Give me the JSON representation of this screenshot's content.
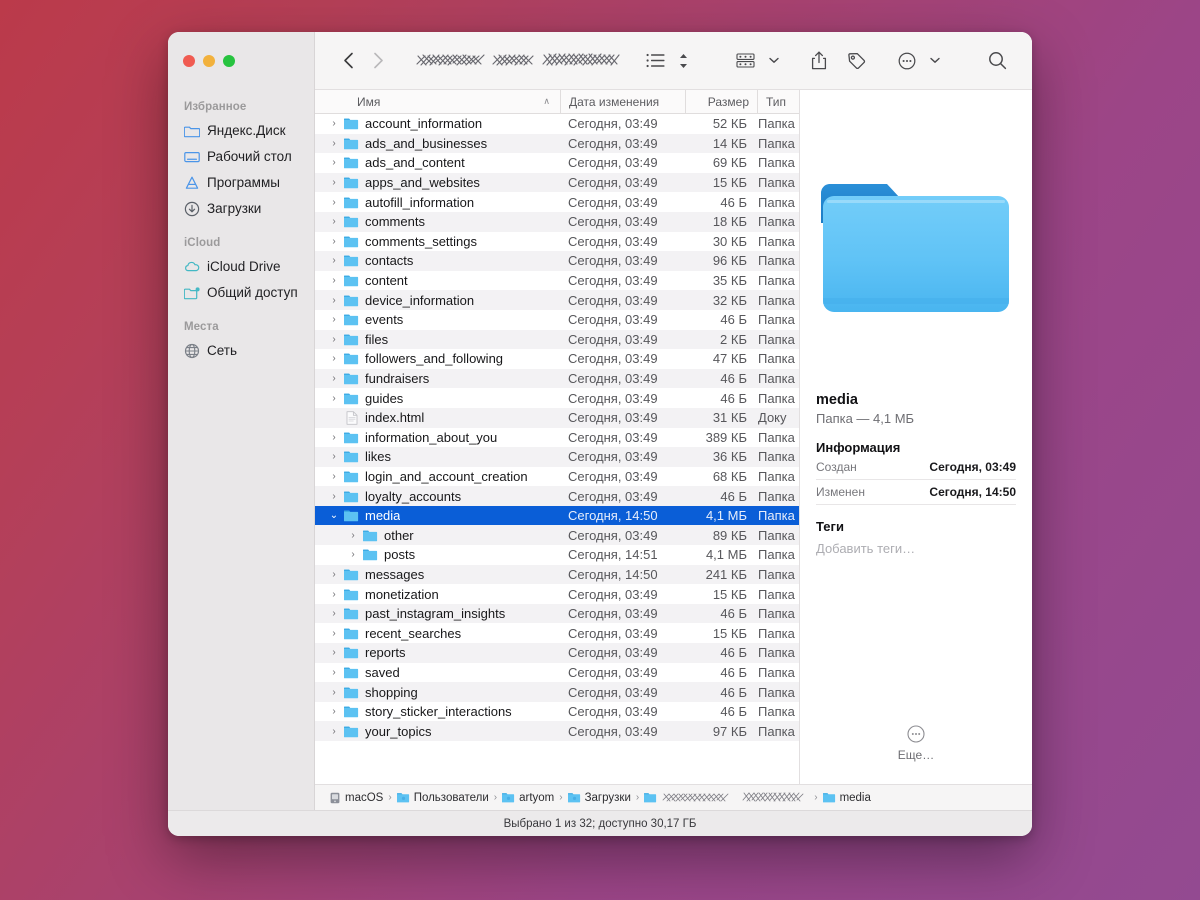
{
  "desktop": {
    "bg_start": "#bb3a4a",
    "bg_end": "#934a91"
  },
  "window": {
    "title_redacted": true,
    "traffic_lights": {
      "close": "close-button",
      "minimize": "minimize-button",
      "zoom": "zoom-button"
    }
  },
  "toolbar": {
    "back_label": "‹",
    "forward_label": "›",
    "view_label": "list-view",
    "group_label": "group-by",
    "share_label": "share",
    "tag_label": "tag",
    "more_label": "more-actions",
    "search_label": "search"
  },
  "sidebar": {
    "sections": [
      {
        "header": "Избранное",
        "items": [
          {
            "label": "Яндекс.Диск",
            "icon": "folder-icon"
          },
          {
            "label": "Рабочий стол",
            "icon": "desktop-icon"
          },
          {
            "label": "Программы",
            "icon": "applications-icon"
          },
          {
            "label": "Загрузки",
            "icon": "downloads-icon"
          }
        ]
      },
      {
        "header": "iCloud",
        "items": [
          {
            "label": "iCloud Drive",
            "icon": "cloud-icon"
          },
          {
            "label": "Общий доступ",
            "icon": "shared-folder-icon"
          }
        ]
      },
      {
        "header": "Места",
        "items": [
          {
            "label": "Сеть",
            "icon": "network-globe-icon"
          }
        ]
      }
    ]
  },
  "columns": {
    "name": "Имя",
    "date": "Дата изменения",
    "size": "Размер",
    "type": "Тип",
    "sort_indicator": "∧"
  },
  "files": [
    {
      "name": "account_information",
      "date": "Сегодня, 03:49",
      "size": "52 КБ",
      "type": "Папка",
      "kind": "folder",
      "twisty": "›",
      "indent": 0,
      "selected": false
    },
    {
      "name": "ads_and_businesses",
      "date": "Сегодня, 03:49",
      "size": "14 КБ",
      "type": "Папка",
      "kind": "folder",
      "twisty": "›",
      "indent": 0,
      "selected": false
    },
    {
      "name": "ads_and_content",
      "date": "Сегодня, 03:49",
      "size": "69 КБ",
      "type": "Папка",
      "kind": "folder",
      "twisty": "›",
      "indent": 0,
      "selected": false
    },
    {
      "name": "apps_and_websites",
      "date": "Сегодня, 03:49",
      "size": "15 КБ",
      "type": "Папка",
      "kind": "folder",
      "twisty": "›",
      "indent": 0,
      "selected": false
    },
    {
      "name": "autofill_information",
      "date": "Сегодня, 03:49",
      "size": "46 Б",
      "type": "Папка",
      "kind": "folder",
      "twisty": "›",
      "indent": 0,
      "selected": false
    },
    {
      "name": "comments",
      "date": "Сегодня, 03:49",
      "size": "18 КБ",
      "type": "Папка",
      "kind": "folder",
      "twisty": "›",
      "indent": 0,
      "selected": false
    },
    {
      "name": "comments_settings",
      "date": "Сегодня, 03:49",
      "size": "30 КБ",
      "type": "Папка",
      "kind": "folder",
      "twisty": "›",
      "indent": 0,
      "selected": false
    },
    {
      "name": "contacts",
      "date": "Сегодня, 03:49",
      "size": "96 КБ",
      "type": "Папка",
      "kind": "folder",
      "twisty": "›",
      "indent": 0,
      "selected": false
    },
    {
      "name": "content",
      "date": "Сегодня, 03:49",
      "size": "35 КБ",
      "type": "Папка",
      "kind": "folder",
      "twisty": "›",
      "indent": 0,
      "selected": false
    },
    {
      "name": "device_information",
      "date": "Сегодня, 03:49",
      "size": "32 КБ",
      "type": "Папка",
      "kind": "folder",
      "twisty": "›",
      "indent": 0,
      "selected": false
    },
    {
      "name": "events",
      "date": "Сегодня, 03:49",
      "size": "46 Б",
      "type": "Папка",
      "kind": "folder",
      "twisty": "›",
      "indent": 0,
      "selected": false
    },
    {
      "name": "files",
      "date": "Сегодня, 03:49",
      "size": "2 КБ",
      "type": "Папка",
      "kind": "folder",
      "twisty": "›",
      "indent": 0,
      "selected": false
    },
    {
      "name": "followers_and_following",
      "date": "Сегодня, 03:49",
      "size": "47 КБ",
      "type": "Папка",
      "kind": "folder",
      "twisty": "›",
      "indent": 0,
      "selected": false
    },
    {
      "name": "fundraisers",
      "date": "Сегодня, 03:49",
      "size": "46 Б",
      "type": "Папка",
      "kind": "folder",
      "twisty": "›",
      "indent": 0,
      "selected": false
    },
    {
      "name": "guides",
      "date": "Сегодня, 03:49",
      "size": "46 Б",
      "type": "Папка",
      "kind": "folder",
      "twisty": "›",
      "indent": 0,
      "selected": false
    },
    {
      "name": "index.html",
      "date": "Сегодня, 03:49",
      "size": "31 КБ",
      "type": "Доку",
      "kind": "document",
      "twisty": "",
      "indent": 0,
      "selected": false
    },
    {
      "name": "information_about_you",
      "date": "Сегодня, 03:49",
      "size": "389 КБ",
      "type": "Папка",
      "kind": "folder",
      "twisty": "›",
      "indent": 0,
      "selected": false
    },
    {
      "name": "likes",
      "date": "Сегодня, 03:49",
      "size": "36 КБ",
      "type": "Папка",
      "kind": "folder",
      "twisty": "›",
      "indent": 0,
      "selected": false
    },
    {
      "name": "login_and_account_creation",
      "date": "Сегодня, 03:49",
      "size": "68 КБ",
      "type": "Папка",
      "kind": "folder",
      "twisty": "›",
      "indent": 0,
      "selected": false
    },
    {
      "name": "loyalty_accounts",
      "date": "Сегодня, 03:49",
      "size": "46 Б",
      "type": "Папка",
      "kind": "folder",
      "twisty": "›",
      "indent": 0,
      "selected": false
    },
    {
      "name": "media",
      "date": "Сегодня, 14:50",
      "size": "4,1 МБ",
      "type": "Папка",
      "kind": "folder",
      "twisty": "⌄",
      "indent": 0,
      "selected": true
    },
    {
      "name": "other",
      "date": "Сегодня, 03:49",
      "size": "89 КБ",
      "type": "Папка",
      "kind": "folder",
      "twisty": "›",
      "indent": 1,
      "selected": false
    },
    {
      "name": "posts",
      "date": "Сегодня, 14:51",
      "size": "4,1 МБ",
      "type": "Папка",
      "kind": "folder",
      "twisty": "›",
      "indent": 1,
      "selected": false
    },
    {
      "name": "messages",
      "date": "Сегодня, 14:50",
      "size": "241 КБ",
      "type": "Папка",
      "kind": "folder",
      "twisty": "›",
      "indent": 0,
      "selected": false
    },
    {
      "name": "monetization",
      "date": "Сегодня, 03:49",
      "size": "15 КБ",
      "type": "Папка",
      "kind": "folder",
      "twisty": "›",
      "indent": 0,
      "selected": false
    },
    {
      "name": "past_instagram_insights",
      "date": "Сегодня, 03:49",
      "size": "46 Б",
      "type": "Папка",
      "kind": "folder",
      "twisty": "›",
      "indent": 0,
      "selected": false
    },
    {
      "name": "recent_searches",
      "date": "Сегодня, 03:49",
      "size": "15 КБ",
      "type": "Папка",
      "kind": "folder",
      "twisty": "›",
      "indent": 0,
      "selected": false
    },
    {
      "name": "reports",
      "date": "Сегодня, 03:49",
      "size": "46 Б",
      "type": "Папка",
      "kind": "folder",
      "twisty": "›",
      "indent": 0,
      "selected": false
    },
    {
      "name": "saved",
      "date": "Сегодня, 03:49",
      "size": "46 Б",
      "type": "Папка",
      "kind": "folder",
      "twisty": "›",
      "indent": 0,
      "selected": false
    },
    {
      "name": "shopping",
      "date": "Сегодня, 03:49",
      "size": "46 Б",
      "type": "Папка",
      "kind": "folder",
      "twisty": "›",
      "indent": 0,
      "selected": false
    },
    {
      "name": "story_sticker_interactions",
      "date": "Сегодня, 03:49",
      "size": "46 Б",
      "type": "Папка",
      "kind": "folder",
      "twisty": "›",
      "indent": 0,
      "selected": false
    },
    {
      "name": "your_topics",
      "date": "Сегодня, 03:49",
      "size": "97 КБ",
      "type": "Папка",
      "kind": "folder",
      "twisty": "›",
      "indent": 0,
      "selected": false
    }
  ],
  "inspector": {
    "icon": "folder-icon-large",
    "title": "media",
    "subtitle": "Папка — 4,1 МБ",
    "info_header": "Информация",
    "info_rows": [
      {
        "key": "Создан",
        "value": "Сегодня, 03:49"
      },
      {
        "key": "Изменен",
        "value": "Сегодня, 14:50"
      }
    ],
    "tags_header": "Теги",
    "tags_placeholder": "Добавить теги…",
    "more_label": "Еще…"
  },
  "pathbar": {
    "crumbs": [
      {
        "label": "macOS",
        "icon": "disk-icon"
      },
      {
        "label": "Пользователи",
        "icon": "users-folder-icon"
      },
      {
        "label": "artyom",
        "icon": "home-folder-icon"
      },
      {
        "label": "Загрузки",
        "icon": "downloads-folder-icon"
      },
      {
        "label": "",
        "icon": "folder-icon",
        "redacted": true
      },
      {
        "label": "media",
        "icon": "folder-icon"
      }
    ],
    "separator": "›"
  },
  "statusbar": {
    "text": "Выбрано 1 из 32; доступно 30,17 ГБ"
  }
}
